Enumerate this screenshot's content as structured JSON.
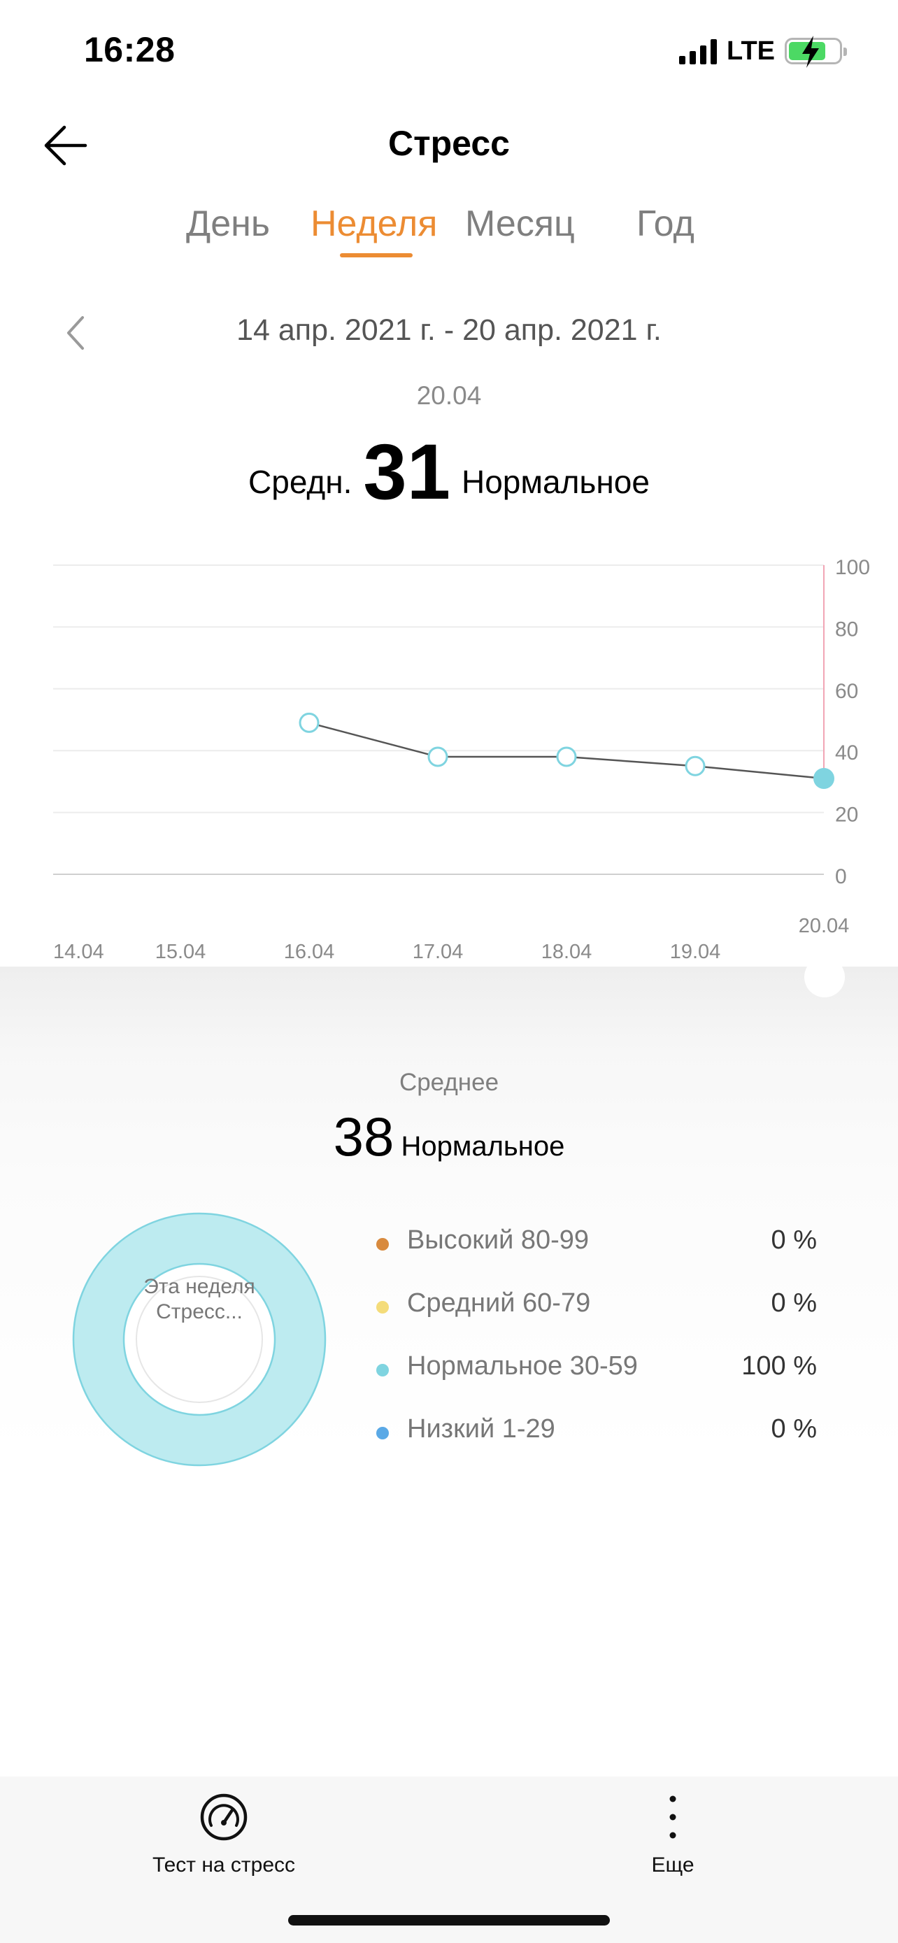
{
  "status_bar": {
    "time": "16:28",
    "network": "LTE",
    "battery_color": "#4cd964"
  },
  "header": {
    "title": "Стресс"
  },
  "tabs": [
    {
      "label": "День",
      "active": false
    },
    {
      "label": "Неделя",
      "active": true
    },
    {
      "label": "Месяц",
      "active": false
    },
    {
      "label": "Год",
      "active": false
    }
  ],
  "range": {
    "text": "14 апр. 2021 г. - 20 апр. 2021 г."
  },
  "selected": {
    "date": "20.04",
    "avg_label": "Средн.",
    "value": "31",
    "status": "Нормальное"
  },
  "colors": {
    "accent": "#ec8c33",
    "normal": "#7fd4e0",
    "high": "#d88a3e",
    "medium": "#f4dc7a",
    "low": "#5aa9e6"
  },
  "chart_data": {
    "type": "line",
    "x": [
      "14.04",
      "15.04",
      "16.04",
      "17.04",
      "18.04",
      "19.04",
      "20.04"
    ],
    "y": [
      null,
      null,
      49,
      38,
      38,
      35,
      31
    ],
    "ylim": [
      0,
      100
    ],
    "yticks": [
      "100",
      "80",
      "60",
      "40",
      "20",
      "0"
    ],
    "selected_index": 6,
    "grid": true
  },
  "summary": {
    "label": "Среднее",
    "value": "38",
    "status": "Нормальное"
  },
  "donut": {
    "center_text": "Эта неделя Стресс...",
    "normal_fraction": 1.0
  },
  "legend": [
    {
      "name": "Высокий 80-99",
      "percent": "0 %",
      "color": "#d88a3e"
    },
    {
      "name": "Средний 60-79",
      "percent": "0 %",
      "color": "#f4dc7a"
    },
    {
      "name": "Нормальное 30-59",
      "percent": "100 %",
      "color": "#7fd4e0"
    },
    {
      "name": "Низкий 1-29",
      "percent": "0 %",
      "color": "#5aa9e6"
    }
  ],
  "toolbar": {
    "stress_test_label": "Тест на стресс",
    "more_label": "Еще"
  }
}
